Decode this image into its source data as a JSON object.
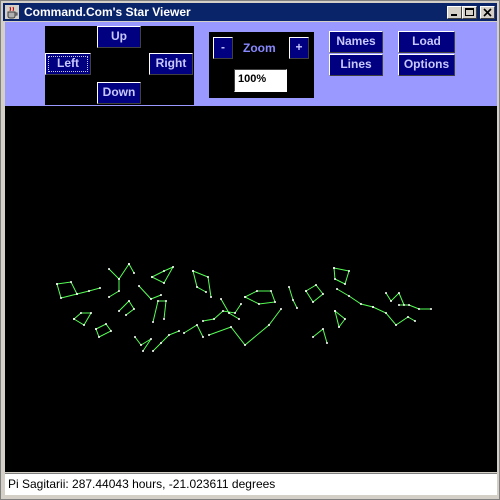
{
  "window": {
    "title": "Command.Com's Star Viewer"
  },
  "nav": {
    "up": "Up",
    "left": "Left",
    "right": "Right",
    "down": "Down"
  },
  "zoom": {
    "minus": "-",
    "label": "Zoom",
    "plus": "+",
    "value": "100%"
  },
  "buttons": {
    "names": "Names",
    "lines": "Lines",
    "load": "Load",
    "options": "Options"
  },
  "status": {
    "text": "Pi Sagitarii: 287.44043 hours, -21.023611 degrees"
  },
  "colors": {
    "toolbar": "#9999ff",
    "button": "#000080",
    "button_text": "#c8c8ff",
    "constellation_lines": "#55ff55",
    "sky": "#000000"
  }
}
